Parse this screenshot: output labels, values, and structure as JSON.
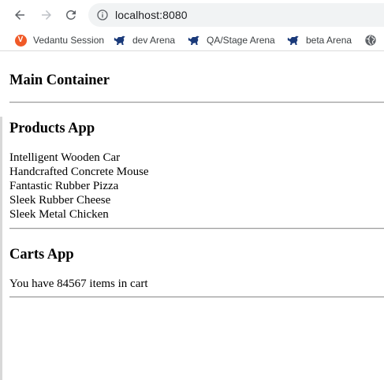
{
  "browser": {
    "url": "localhost:8080",
    "bookmarks": [
      {
        "label": "Vedantu Session",
        "icon": "vedantu-logo-icon"
      },
      {
        "label": "dev Arena",
        "icon": "bull-icon"
      },
      {
        "label": "QA/Stage Arena",
        "icon": "bull-icon"
      },
      {
        "label": "beta Arena",
        "icon": "bull-icon"
      },
      {
        "label": "",
        "icon": "globe-icon"
      }
    ],
    "vedantu_letter": "V",
    "colors": {
      "vedantu": "#f05a28",
      "bull": "#1a3a7a",
      "icon_gray": "#5f6368"
    }
  },
  "main": {
    "title": "Main Container"
  },
  "products": {
    "title": "Products App",
    "items": [
      "Intelligent Wooden Car",
      "Handcrafted Concrete Mouse",
      "Fantastic Rubber Pizza",
      "Sleek Rubber Cheese",
      "Sleek Metal Chicken"
    ]
  },
  "carts": {
    "title": "Carts App",
    "message": "You have 84567 items in cart"
  }
}
